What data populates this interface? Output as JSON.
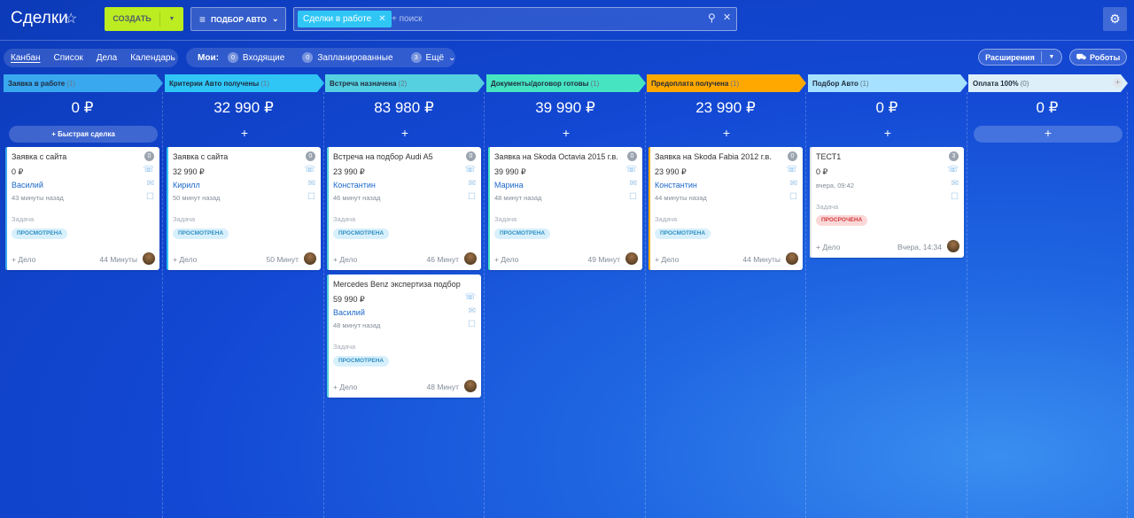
{
  "header": {
    "title": "Сделки",
    "create": "СОЗДАТЬ",
    "filter": "ПОДБОР АВТО",
    "chip": "Сделки в работе",
    "search_placeholder": "+ поиск"
  },
  "views": [
    "Канбан",
    "Список",
    "Дела",
    "Календарь"
  ],
  "counters": {
    "label": "Мои:",
    "items": [
      {
        "n": "0",
        "label": "Входящие"
      },
      {
        "n": "0",
        "label": "Запланированные"
      },
      {
        "n": "3",
        "label": "Ещё"
      }
    ]
  },
  "actions": {
    "extensions": "Расширения",
    "robots": "Роботы"
  },
  "columns": [
    {
      "title": "Заявка в работе",
      "count": "(1)",
      "sum": "0 ₽",
      "color": "#39a8ef",
      "quick": "+ Быстрая сделка",
      "add": ""
    },
    {
      "title": "Критерии Авто получены",
      "count": "(1)",
      "sum": "32 990 ₽",
      "color": "#2fc6f6",
      "quick": "",
      "add": "+"
    },
    {
      "title": "Встреча назначена",
      "count": "(2)",
      "sum": "83 980 ₽",
      "color": "#55d0e0",
      "quick": "",
      "add": "+"
    },
    {
      "title": "Документы/договор готовы",
      "count": "(1)",
      "sum": "39 990 ₽",
      "color": "#47e4c2",
      "quick": "",
      "add": "+"
    },
    {
      "title": "Предоплата получена",
      "count": "(1)",
      "sum": "23 990 ₽",
      "color": "#ffa900",
      "quick": "",
      "add": "+"
    },
    {
      "title": "Подбор Авто",
      "count": "(1)",
      "sum": "0 ₽",
      "color": "#a6e1ff",
      "quick": "",
      "add": "+"
    },
    {
      "title": "Оплата 100%",
      "count": "(0)",
      "sum": "0 ₽",
      "color": "#ddeff8",
      "quick": "",
      "add": "+",
      "plus": "+"
    }
  ],
  "cards": [
    {
      "title": "Заявка с сайта",
      "price": "0 ₽",
      "name": "Василий",
      "meta": "43 минуты назад",
      "task": "Задача",
      "tag": "ПРОСМОТРЕНА",
      "add": "+ Дело",
      "time": "44 Минуты",
      "badge": "0"
    },
    {
      "title": "Заявка с сайта",
      "price": "32 990 ₽",
      "name": "Кирилл",
      "meta": "50 минут назад",
      "task": "Задача",
      "tag": "ПРОСМОТРЕНА",
      "add": "+ Дело",
      "time": "50 Минут",
      "badge": "0"
    },
    {
      "title": "Встреча на подбор Audi A5",
      "price": "23 990 ₽",
      "name": "Константин",
      "meta": "46 минут назад",
      "task": "Задача",
      "tag": "ПРОСМОТРЕНА",
      "add": "+ Дело",
      "time": "46 Минут",
      "badge": "0"
    },
    {
      "title": "Mercedes Benz экспертиза подбор",
      "price": "59 990 ₽",
      "name": "Василий",
      "meta": "48 минут назад",
      "task": "Задача",
      "tag": "ПРОСМОТРЕНА",
      "add": "+ Дело",
      "time": "48 Минут",
      "badge": ""
    },
    {
      "title": "Заявка на Skoda Octavia 2015 г.в.",
      "price": "39 990 ₽",
      "name": "Марина",
      "meta": "48 минут назад",
      "task": "Задача",
      "tag": "ПРОСМОТРЕНА",
      "add": "+ Дело",
      "time": "49 Минут",
      "badge": "0"
    },
    {
      "title": "Заявка на Skoda Fabia 2012 г.в.",
      "price": "23 990 ₽",
      "name": "Константин",
      "meta": "44 минуты назад",
      "task": "Задача",
      "tag": "ПРОСМОТРЕНА",
      "add": "+ Дело",
      "time": "44 Минуты",
      "badge": "0"
    },
    {
      "title": "ТЕСТ1",
      "price": "0 ₽",
      "name": "",
      "meta": "вчера, 09:42",
      "task": "Задача",
      "tag": "ПРОСРОЧЕНА",
      "add": "+ Дело",
      "time": "Вчера, 14:34",
      "badge": "3"
    }
  ]
}
